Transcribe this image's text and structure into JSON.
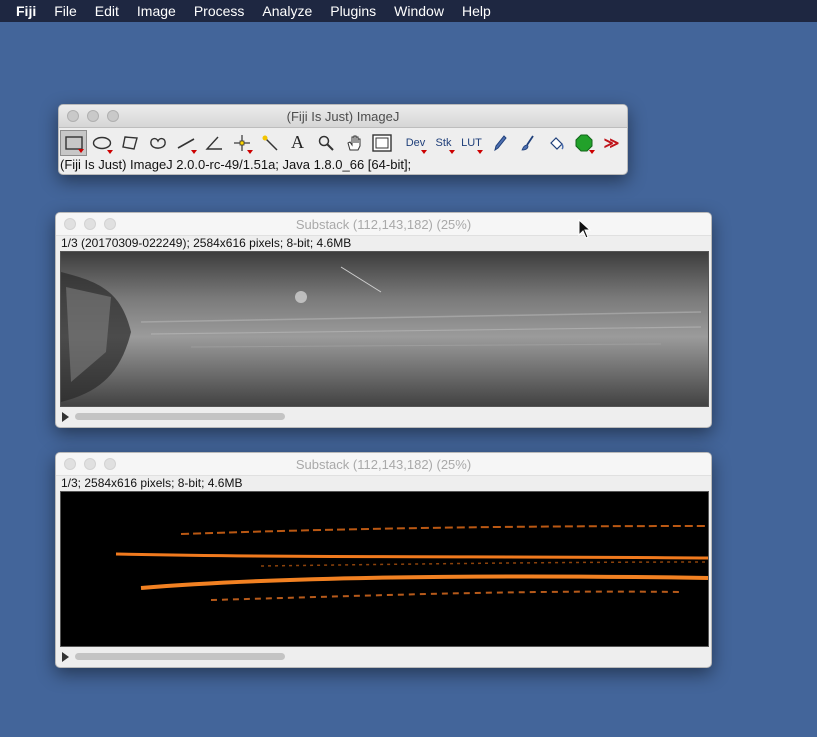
{
  "menubar": {
    "items": [
      "Fiji",
      "File",
      "Edit",
      "Image",
      "Process",
      "Analyze",
      "Plugins",
      "Window",
      "Help"
    ]
  },
  "toolbar_window": {
    "title": "(Fiji Is Just) ImageJ",
    "status": "(Fiji Is Just) ImageJ 2.0.0-rc-49/1.51a; Java 1.8.0_66 [64-bit];",
    "text_tools": {
      "dev": "Dev",
      "stk": "Stk",
      "lut": "LUT",
      "more": "≫",
      "text_tool": "A"
    }
  },
  "image_windows": [
    {
      "title": "Substack (112,143,182) (25%)",
      "info": "1/3 (20170309-022249); 2584x616 pixels; 8-bit; 4.6MB",
      "colors": {
        "background": "#5a5a5a",
        "stripe": "#9a9a9a"
      }
    },
    {
      "title": "Substack (112,143,182) (25%)",
      "info": "1/3; 2584x616 pixels; 8-bit; 4.6MB",
      "colors": {
        "background": "#000000",
        "trace": "#f07a1e"
      }
    }
  ],
  "colors": {
    "desktop": "#43659a",
    "menubar": "#1e2741"
  }
}
